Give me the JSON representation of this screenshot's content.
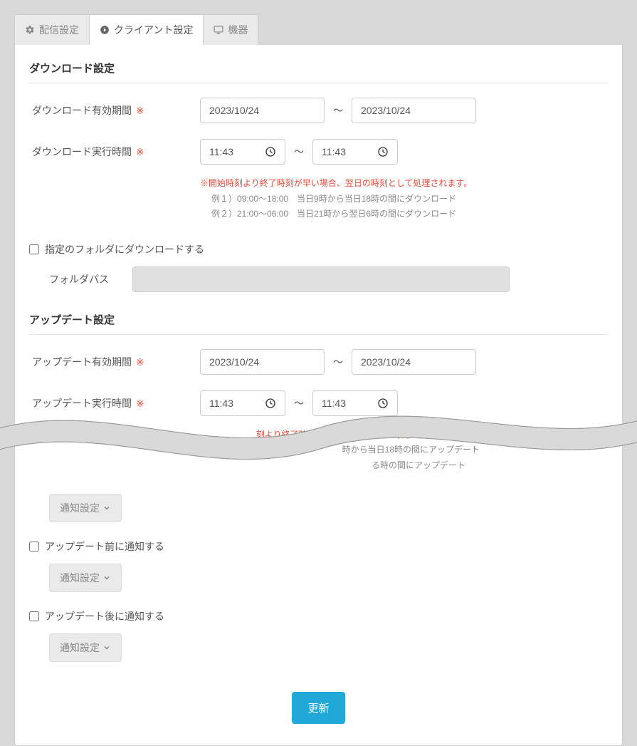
{
  "tabs": {
    "distribution": "配信設定",
    "client": "クライアント設定",
    "device": "機器"
  },
  "download": {
    "section_title": "ダウンロード設定",
    "period_label": "ダウンロード有効期間",
    "time_label": "ダウンロード実行時間",
    "req_mark": "※",
    "date_start": "2023/10/24",
    "date_end": "2023/10/24",
    "time_start": "11:43",
    "time_end": "11:43",
    "tilde": "～",
    "note_line1": "※開始時刻より終了時刻が早い場合、翌日の時刻として処理されます。",
    "note_line2": "例１）09:00～18:00　当日9時から当日18時の間にダウンロード",
    "note_line3": "例２）21:00～06:00　当日21時から翌日6時の間にダウンロード",
    "folder_checkbox": "指定のフォルダにダウンロードする",
    "folder_label": "フォルダパス"
  },
  "update": {
    "section_title": "アップデート設定",
    "period_label": "アップデート有効期間",
    "time_label": "アップデート実行時間",
    "date_start": "2023/10/24",
    "date_end": "2023/10/24",
    "time_start": "11:43",
    "time_end": "11:43",
    "note_suffix1": "刻より終了時刻が早い場合、翌日の時刻として処理されます。",
    "note_suffix2": "時から当日18時の間にアップデート",
    "note_suffix3": "る時の間にアップデート",
    "notify_button": "通知設定",
    "notify_before": "アップデート前に通知する",
    "notify_after": "アップデート後に通知する"
  },
  "submit": "更新"
}
